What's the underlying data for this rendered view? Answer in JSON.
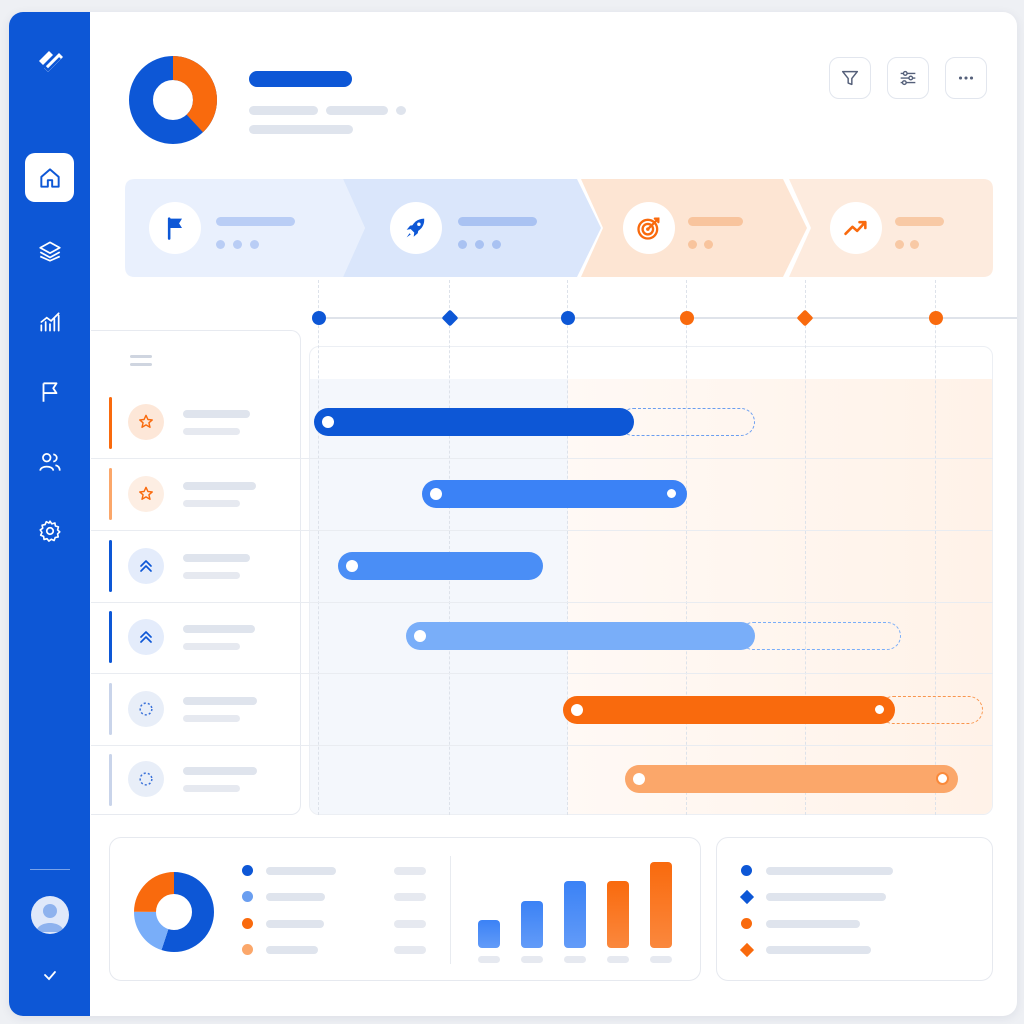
{
  "colors": {
    "primary_blue": "#0d57d6",
    "mid_blue": "#3b82f6",
    "light_blue": "#79aef9",
    "orange": "#f96a0d",
    "light_orange": "#fba76a",
    "placeholder_gray": "#dfe4ed"
  },
  "sidebar": {
    "logo": "app-logo",
    "items": [
      {
        "icon": "home-icon",
        "active": true
      },
      {
        "icon": "layers-icon",
        "active": false
      },
      {
        "icon": "analytics-icon",
        "active": false
      },
      {
        "icon": "flag-icon",
        "active": false
      },
      {
        "icon": "users-icon",
        "active": false
      },
      {
        "icon": "settings-icon",
        "active": false
      }
    ],
    "bottom": [
      "user-avatar",
      "chevron-down-icon"
    ]
  },
  "header": {
    "summary_donut": {
      "blue_share": 0.62,
      "orange_share": 0.38
    },
    "actions": [
      "filter-icon",
      "sliders-icon",
      "more-icon"
    ]
  },
  "phases": [
    {
      "icon": "flag-icon",
      "tone": "blue",
      "progress_dots": 3
    },
    {
      "icon": "rocket-icon",
      "tone": "blue",
      "progress_dots": 3
    },
    {
      "icon": "target-icon",
      "tone": "orange",
      "progress_dots": 2
    },
    {
      "icon": "trend-up-icon",
      "tone": "orange",
      "progress_dots": 2
    }
  ],
  "milestones": [
    {
      "shape": "circle",
      "color": "blue"
    },
    {
      "shape": "diamond",
      "color": "blue"
    },
    {
      "shape": "circle",
      "color": "blue"
    },
    {
      "shape": "circle",
      "color": "orange"
    },
    {
      "shape": "diamond",
      "color": "orange"
    },
    {
      "shape": "circle",
      "color": "orange"
    }
  ],
  "tasks": [
    {
      "icon": "star-icon",
      "tone": "orange",
      "bar_color": "primary_blue",
      "has_extension": true,
      "end_marker": false
    },
    {
      "icon": "star-icon",
      "tone": "orange",
      "bar_color": "mid_blue",
      "has_extension": false,
      "end_marker": true
    },
    {
      "icon": "chevrons-up-icon",
      "tone": "blue",
      "bar_color": "mid_blue",
      "has_extension": false,
      "end_marker": false
    },
    {
      "icon": "chevrons-up-icon",
      "tone": "blue",
      "bar_color": "light_blue",
      "has_extension": true,
      "end_marker": false
    },
    {
      "icon": "dashed-circle-icon",
      "tone": "neutral",
      "bar_color": "orange",
      "has_extension": true,
      "end_marker": true
    },
    {
      "icon": "dashed-circle-icon",
      "tone": "neutral",
      "bar_color": "light_orange",
      "has_extension": false,
      "end_marker": true
    }
  ],
  "bottom_summary": {
    "donut_shares": [
      {
        "color": "primary_blue",
        "share": 0.55
      },
      {
        "color": "light_blue",
        "share": 0.2
      },
      {
        "color": "orange",
        "share": 0.25
      }
    ],
    "legend_colors": [
      "primary_blue",
      "mid_blue",
      "orange",
      "light_orange"
    ],
    "mini_bars": [
      {
        "color": "mid_blue",
        "level": 0.32
      },
      {
        "color": "mid_blue",
        "level": 0.55
      },
      {
        "color": "mid_blue",
        "level": 0.78
      },
      {
        "color": "orange",
        "level": 0.78
      },
      {
        "color": "orange",
        "level": 1.0
      }
    ]
  },
  "key_legend": [
    {
      "shape": "circle",
      "color": "primary_blue"
    },
    {
      "shape": "diamond",
      "color": "primary_blue"
    },
    {
      "shape": "circle",
      "color": "orange"
    },
    {
      "shape": "diamond",
      "color": "orange"
    }
  ]
}
